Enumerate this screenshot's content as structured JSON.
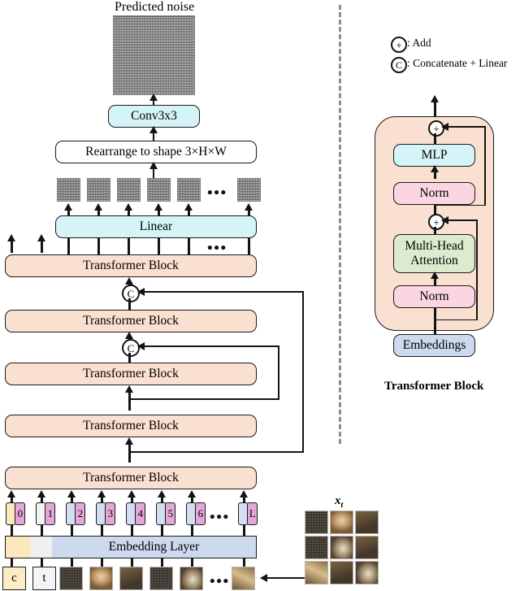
{
  "figure": {
    "title_top": "Predicted noise",
    "xt_label": "x",
    "xt_sub": "t",
    "right_caption": "Transformer Block"
  },
  "legend": {
    "add_symbol": "+",
    "add_text": ": Add",
    "concat_symbol": "C",
    "concat_text": ": Concatenate + Linear"
  },
  "left_pipeline": {
    "conv_label": "Conv3x3",
    "rearrange_label": "Rearrange to shape 3×H×W",
    "linear_label": "Linear",
    "transformer_label": "Transformer Block",
    "embedding_layer_label": "Embedding Layer",
    "ellipsis": "•••",
    "concat_symbol": "C",
    "transformer_blocks": [
      {
        "label": "Transformer Block"
      },
      {
        "label": "Transformer Block"
      },
      {
        "label": "Transformer Block"
      },
      {
        "label": "Transformer Block"
      },
      {
        "label": "Transformer Block"
      },
      {
        "label": "Transformer Block"
      }
    ],
    "tokens": [
      {
        "index": "0",
        "left_color": "#fbe8bd",
        "left_class": "tok-cream"
      },
      {
        "index": "1",
        "left_color": "#f3f3f3",
        "left_class": "tok-white"
      },
      {
        "index": "2",
        "left_color": "#d3def0",
        "left_class": "tok-blue"
      },
      {
        "index": "3",
        "left_color": "#d3def0",
        "left_class": "tok-blue"
      },
      {
        "index": "4",
        "left_color": "#d3def0",
        "left_class": "tok-blue"
      },
      {
        "index": "5",
        "left_color": "#d3def0",
        "left_class": "tok-blue"
      },
      {
        "index": "6",
        "left_color": "#d3def0",
        "left_class": "tok-blue"
      },
      {
        "index": "L",
        "left_color": "#d3def0",
        "left_class": "tok-blue"
      }
    ],
    "inputs": [
      {
        "label": "c",
        "kind": "cream"
      },
      {
        "label": "t",
        "kind": "white"
      },
      {
        "label": "",
        "kind": "patch-dark"
      },
      {
        "label": "",
        "kind": "patch-dog"
      },
      {
        "label": "",
        "kind": "patch-mid"
      },
      {
        "label": "",
        "kind": "patch-dark"
      },
      {
        "label": "",
        "kind": "patch-light"
      },
      {
        "label": "",
        "kind": "patch-leg"
      }
    ],
    "output_patch_count": 6
  },
  "transformer_detail": {
    "caption": "Transformer Block",
    "mlp_label": "MLP",
    "norm_top_label": "Norm",
    "attention_label_line1": "Multi-Head",
    "attention_label_line2": "Attention",
    "norm_bottom_label": "Norm",
    "embeddings_label": "Embeddings",
    "add_symbol": "+"
  },
  "colors": {
    "transformer_block": "#fae0d0",
    "linear_cyan": "#d4f4f8",
    "norm_pink": "#fbd5e2",
    "attention_green": "#dcead0",
    "embeddings_blue": "#ccd9ee",
    "token_index_pink": "#e2a8d8",
    "token_cream": "#fbe8bd",
    "token_blue": "#d3def0",
    "stroke": "#141414",
    "divider": "#8d8d8d"
  }
}
